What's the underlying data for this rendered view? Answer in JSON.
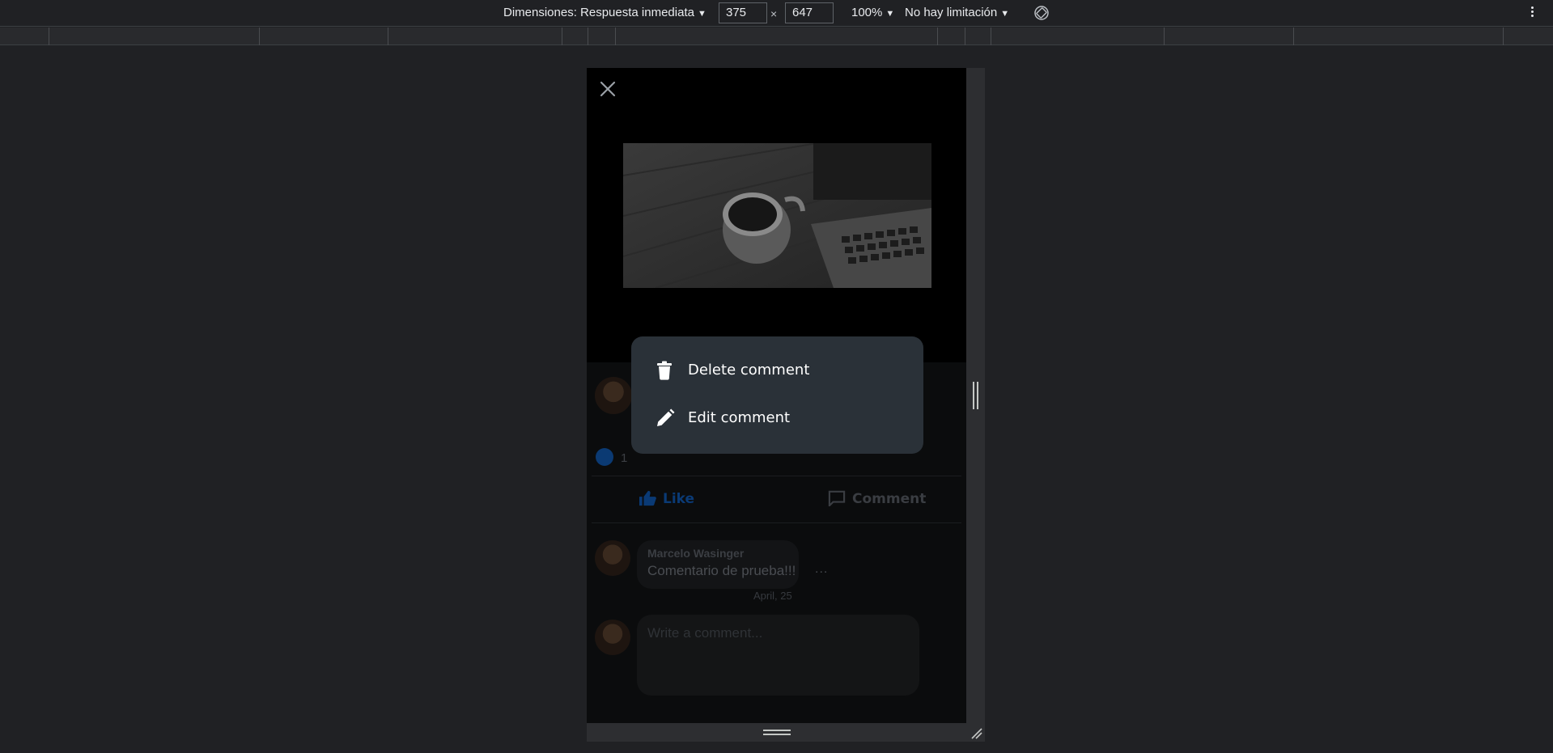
{
  "devtools": {
    "dimensions_label": "Dimensiones: Respuesta inmediata",
    "width_value": "375",
    "times": "×",
    "height_value": "647",
    "zoom": "100%",
    "throttle": "No hay limitación",
    "caret": "▼"
  },
  "post": {
    "reaction_count": "1",
    "like_label": "Like",
    "comment_label": "Comment"
  },
  "comment": {
    "author": "Marcelo Wasinger",
    "text": "Comentario de prueba!!!",
    "more": "...",
    "date": "April, 25"
  },
  "composer": {
    "placeholder": "Write a comment..."
  },
  "context_menu": {
    "delete_label": "Delete comment",
    "edit_label": "Edit comment"
  },
  "colors": {
    "menu_bg": "#2a3138",
    "like_blue": "#1877f2",
    "devtools_bg": "#202124"
  },
  "icons": [
    "close-icon",
    "trash-icon",
    "pencil-icon",
    "thumbs-up-icon",
    "comment-icon",
    "rotate-icon",
    "kebab-menu-icon"
  ]
}
